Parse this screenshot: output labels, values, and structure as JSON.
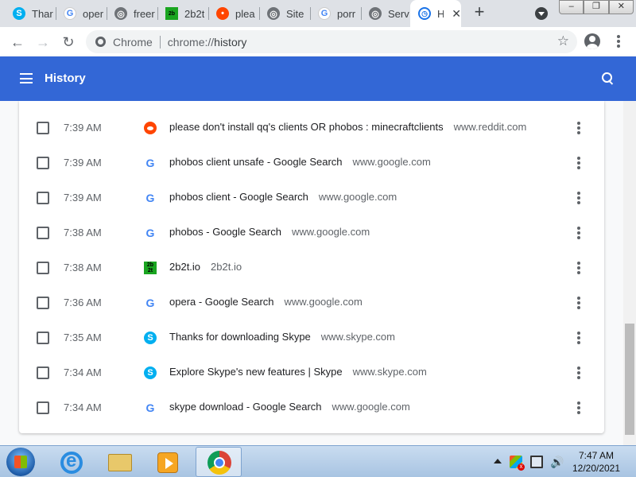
{
  "tabs": [
    {
      "title": "Thar",
      "icon": "skype-icon"
    },
    {
      "title": "oper",
      "icon": "google-icon"
    },
    {
      "title": "freer",
      "icon": "globe-icon"
    },
    {
      "title": "2b2t",
      "icon": "2b2t-icon"
    },
    {
      "title": "plea",
      "icon": "reddit-icon"
    },
    {
      "title": "Site",
      "icon": "globe-icon"
    },
    {
      "title": "porr",
      "icon": "google-icon"
    },
    {
      "title": "Serv",
      "icon": "globe-icon"
    },
    {
      "title": "H",
      "icon": "history-icon",
      "active": true
    }
  ],
  "window_buttons": {
    "minimize": "–",
    "restore": "❐",
    "close": "✕"
  },
  "toolbar": {
    "back": "←",
    "forward": "→",
    "reload": "↻",
    "chip": "Chrome",
    "url_scheme": "chrome://",
    "url_path": "history",
    "bookmark": "☆"
  },
  "history_header": {
    "title": "History"
  },
  "entries": [
    {
      "time": "7:39 AM",
      "icon": "reddit-icon",
      "title": "please don't install qq's clients OR phobos : minecraftclients",
      "domain": "www.reddit.com"
    },
    {
      "time": "7:39 AM",
      "icon": "google-icon",
      "title": "phobos client unsafe - Google Search",
      "domain": "www.google.com"
    },
    {
      "time": "7:39 AM",
      "icon": "google-icon",
      "title": "phobos client - Google Search",
      "domain": "www.google.com"
    },
    {
      "time": "7:38 AM",
      "icon": "google-icon",
      "title": "phobos - Google Search",
      "domain": "www.google.com"
    },
    {
      "time": "7:38 AM",
      "icon": "2b2t-icon",
      "title": "2b2t.io",
      "domain": "2b2t.io"
    },
    {
      "time": "7:36 AM",
      "icon": "google-icon",
      "title": "opera - Google Search",
      "domain": "www.google.com"
    },
    {
      "time": "7:35 AM",
      "icon": "skype-icon",
      "title": "Thanks for downloading Skype",
      "domain": "www.skype.com"
    },
    {
      "time": "7:34 AM",
      "icon": "skype-icon",
      "title": "Explore Skype's new features | Skype",
      "domain": "www.skype.com"
    },
    {
      "time": "7:34 AM",
      "icon": "google-icon",
      "title": "skype download - Google Search",
      "domain": "www.google.com"
    }
  ],
  "taskbar": {
    "time": "7:47 AM",
    "date": "12/20/2021"
  },
  "colors": {
    "header_blue": "#3367d6",
    "tab_strip": "#dee1e6",
    "reddit": "#ff4500",
    "skype": "#00aff0",
    "google_blue": "#4285f4"
  }
}
